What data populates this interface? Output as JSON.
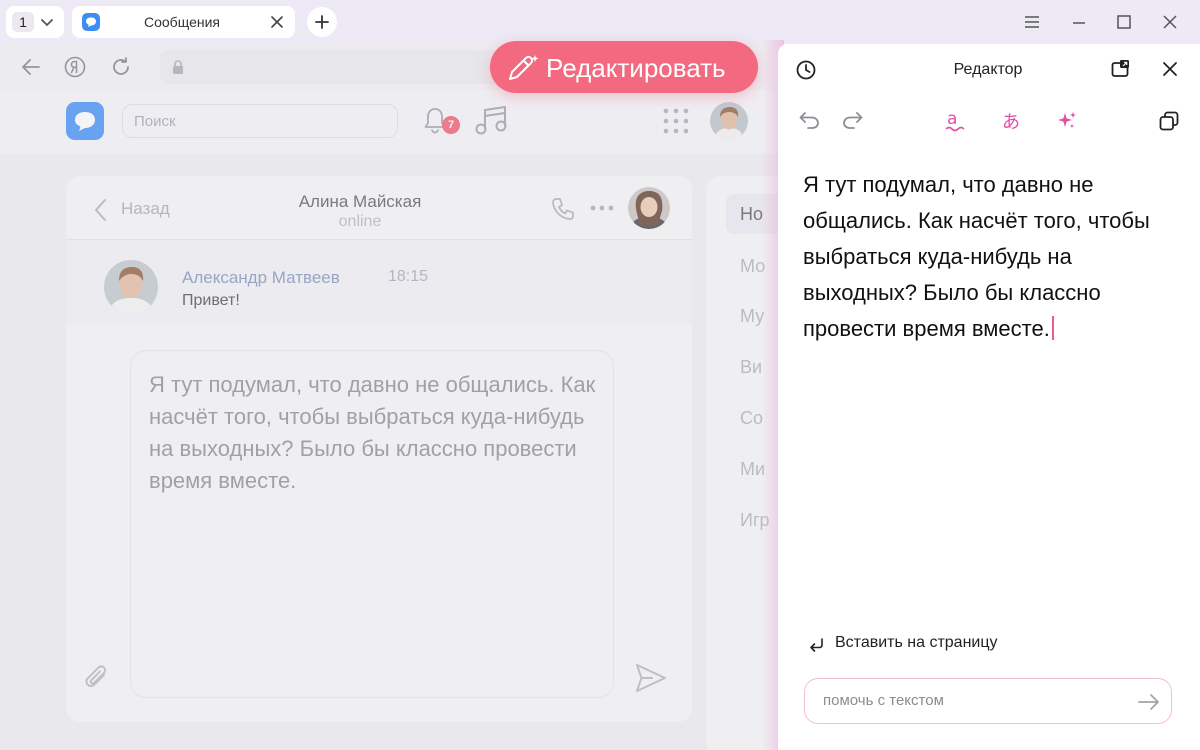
{
  "browser": {
    "tab_count": "1",
    "active_tab_title": "Сообщения"
  },
  "messenger": {
    "search_placeholder": "Поиск",
    "notification_count": "7",
    "chat": {
      "back_label": "Назад",
      "contact_name": "Алина Майская",
      "contact_status": "online",
      "message": {
        "author": "Александр Матвеев",
        "time": "18:15",
        "text": "Привет!"
      },
      "composer_text": "Я тут подумал, что давно не общались. Как насчёт того, чтобы выбраться куда-нибудь на выходных? Было бы классно провести время вместе."
    },
    "side_menu": [
      "Но",
      "Мо",
      "Му",
      "Ви",
      "Со",
      "Ми",
      "Игр"
    ]
  },
  "edit_button": {
    "label": "Редактировать"
  },
  "editor": {
    "title": "Редактор",
    "text": "Я тут подумал, что давно не общались. Как насчёт того, чтобы выбраться куда-нибудь на выходных? Было бы классно провести время вместе.",
    "insert_label": "Вставить на страницу",
    "help_placeholder": "помочь с текстом"
  },
  "colors": {
    "accent_pink": "#f3697f",
    "messenger_blue": "#3d8df5",
    "badge_red": "#f3566a"
  }
}
